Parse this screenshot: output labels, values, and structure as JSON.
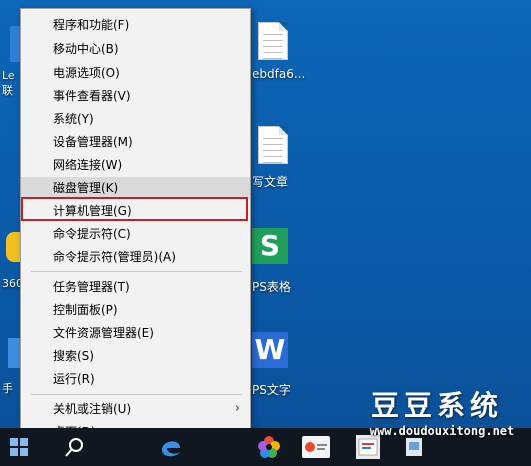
{
  "desktop": {
    "icons": [
      {
        "label": "Le 联"
      },
      {
        "label": "ebdfa6..."
      },
      {
        "label": "写文章"
      },
      {
        "label": "360"
      },
      {
        "label": "PS表格"
      },
      {
        "label": "手"
      },
      {
        "label": "PS文字"
      }
    ]
  },
  "context_menu": {
    "items": [
      {
        "label": "程序和功能(F)"
      },
      {
        "label": "移动中心(B)"
      },
      {
        "label": "电源选项(O)"
      },
      {
        "label": "事件查看器(V)"
      },
      {
        "label": "系统(Y)"
      },
      {
        "label": "设备管理器(M)"
      },
      {
        "label": "网络连接(W)"
      },
      {
        "label": "磁盘管理(K)"
      },
      {
        "label": "计算机管理(G)"
      },
      {
        "label": "命令提示符(C)"
      },
      {
        "label": "命令提示符(管理员)(A)"
      },
      {
        "label": "任务管理器(T)"
      },
      {
        "label": "控制面板(P)"
      },
      {
        "label": "文件资源管理器(E)"
      },
      {
        "label": "搜索(S)"
      },
      {
        "label": "运行(R)"
      },
      {
        "label": "关机或注销(U)"
      },
      {
        "label": "桌面(D)"
      }
    ],
    "hovered_item": "磁盘管理(K)",
    "annotated_item": "计算机管理(G)",
    "annotation_color": "#c0222a"
  },
  "watermark": {
    "title": "豆豆系统",
    "url": "www.doudouxitong.net"
  },
  "taskbar": {
    "items": [
      "windows-start-icon",
      "search-icon",
      "edge-icon",
      "photos-icon",
      "sogou-icon",
      "wps-icon",
      "app-icon"
    ]
  }
}
